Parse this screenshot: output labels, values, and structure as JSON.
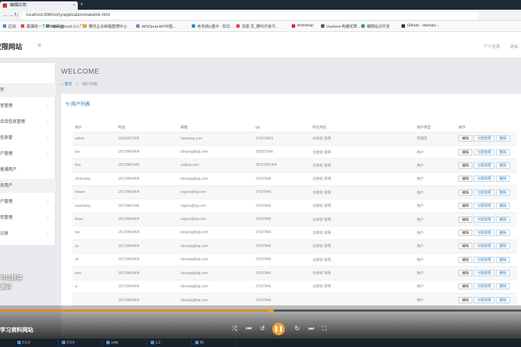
{
  "browser": {
    "tab_title": "编辑应用",
    "url": "localhost:8080/ctrly/application/makelink.html",
    "bookmarks": [
      "应用",
      "慕课网一下 - 中邮网址",
      "SpringBoot2.0入门 -",
      "腾讯企业邮箱管理中心",
      "APICloud API中国...",
      "老毛桃U盘中 - 知识...",
      "百度 京_腾讯开放平...",
      "bootstrap",
      "Vueform 构建优质...",
      "编程站点开发",
      "GitHub - starngui..."
    ]
  },
  "app": {
    "logo": "权限网站",
    "menu_icon": "≡",
    "header_right": [
      "个人信息",
      "退出"
    ]
  },
  "sidebar": {
    "items": [
      {
        "label": "",
        "has_chevron": false
      },
      {
        "label": "页",
        "has_chevron": false,
        "active": true
      },
      {
        "label": "室管理",
        "has_chevron": true
      },
      {
        "label": "合流信息管理",
        "has_chevron": true
      },
      {
        "label": "信息管",
        "has_chevron": true
      },
      {
        "label": "户管理",
        "has_chevron": true
      },
      {
        "label": "普通用户",
        "has_chevron": false
      },
      {
        "label": "员用户",
        "has_chevron": false,
        "active": true
      },
      {
        "label": "户管理",
        "has_chevron": true
      },
      {
        "label": "信管理",
        "has_chevron": true
      },
      {
        "label": "记录",
        "has_chevron": true
      }
    ]
  },
  "main": {
    "welcome": "WELCOME",
    "breadcrumb": {
      "home": "首页",
      "current": "用户列表"
    },
    "card_title": "用户列表"
  },
  "table": {
    "headers": [
      "用户",
      "电话",
      "邮箱",
      "qq",
      "所在地址",
      "用户类型",
      "操作"
    ],
    "actions": {
      "edit": "编辑",
      "permission": "分配权限",
      "delete": "删除"
    },
    "rows": [
      [
        "admin",
        "13155927825",
        "haowang.com",
        "376279953",
        "云南省 昆明",
        "管理员"
      ],
      [
        "lau",
        "15178456404",
        "luhuang@qq.com",
        "362922540",
        "云南省 昆明",
        "用户"
      ],
      [
        "liuq",
        "15178487046",
        "yz@qq.com",
        "36757001404",
        "云南省 昆明",
        "用户"
      ],
      [
        "zhuhuang",
        "15178456404",
        "luhuang@qq.com",
        "37637846",
        "云南省 昆明",
        "用户"
      ],
      [
        "leiwan",
        "15178456404",
        "xsgsxs@qq.com",
        "37637846",
        "云南省 昆明",
        "用户"
      ],
      [
        "zuanhang",
        "15178487046",
        "xsgsxs@qq.com",
        "37637846",
        "云南省 昆明",
        "用户"
      ],
      [
        "lixiao",
        "15178456404",
        "xsgsxs@qq.com",
        "37637846",
        "云南省 昆明",
        "用户"
      ],
      [
        "tao",
        "15178456404",
        "luhuang@qq.com",
        "37637846",
        "云南省 昆明",
        "用户"
      ],
      [
        "yu",
        "15178456404",
        "luhuang@qq.com",
        "37637846",
        "云南省 昆明",
        "用户"
      ],
      [
        "yh",
        "15178456404",
        "luhuang@qq.com",
        "37637846",
        "云南省 昆明",
        "用户"
      ],
      [
        "wen",
        "15178456404",
        "luhuang@qq.com",
        "37637846",
        "云南省 昆明",
        "用户"
      ],
      [
        "yi",
        "15178456404",
        "luhuang@qq.com",
        "37637846",
        "云南省 昆明",
        "用户"
      ],
      [
        "",
        "15178456404",
        "luhuang@qq.com",
        "37637846",
        "",
        "用户"
      ]
    ]
  },
  "player": {
    "progress": 0.52,
    "caption": "学习资料网站",
    "overlay_lines": [
      "可以获得",
      "源码"
    ]
  },
  "taskbar": {
    "items": [
      "2.5.0",
      "2.0.0",
      "unity",
      "1.2",
      "B1"
    ]
  }
}
